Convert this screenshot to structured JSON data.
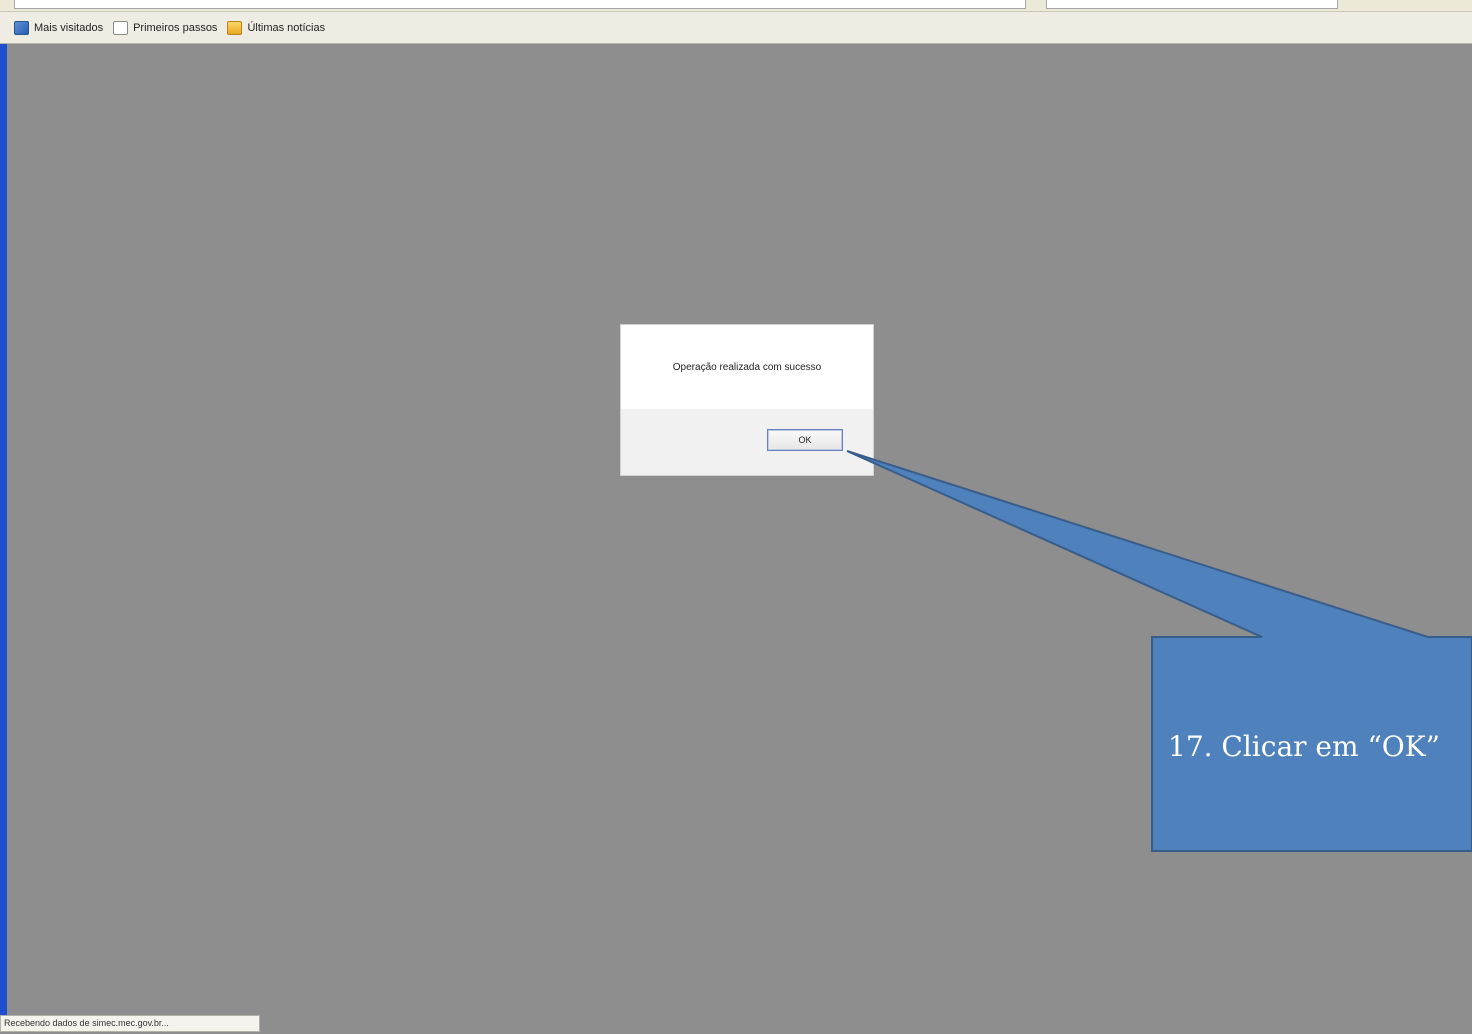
{
  "bookmarks_bar": {
    "items": [
      {
        "label": "Mais visitados",
        "icon": "bookmark-folder-icon"
      },
      {
        "label": "Primeiros passos",
        "icon": "page-icon"
      },
      {
        "label": "Últimas notícias",
        "icon": "rss-folder-icon"
      }
    ]
  },
  "dialog": {
    "message": "Operação realizada com sucesso",
    "ok_label": "OK"
  },
  "callout": {
    "text": "17. Clicar em “OK”",
    "color": "#4f81bd",
    "border_color": "#385d8a"
  },
  "status_bar": {
    "text": "Recebendo dados de simec.mec.gov.br..."
  },
  "colors": {
    "backdrop": "#8e8e8e",
    "window_frame": "#1f4fcf"
  }
}
